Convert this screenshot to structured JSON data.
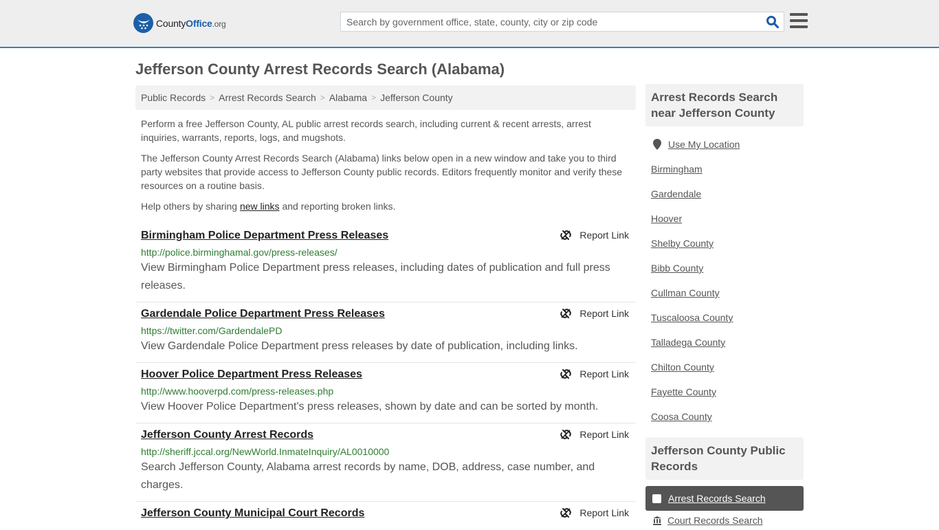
{
  "header": {
    "logo": {
      "county": "County",
      "office": "Office",
      "org": ".org"
    },
    "search_placeholder": "Search by government office, state, county, city or zip code",
    "search_value": ""
  },
  "page_title": "Jefferson County Arrest Records Search (Alabama)",
  "breadcrumb": [
    {
      "label": "Public Records"
    },
    {
      "label": "Arrest Records Search"
    },
    {
      "label": "Alabama"
    },
    {
      "label": "Jefferson County"
    }
  ],
  "intro": {
    "p1": "Perform a free Jefferson County, AL public arrest records search, including current & recent arrests, arrest inquiries, warrants, reports, logs, and mugshots.",
    "p2": "The Jefferson County Arrest Records Search (Alabama) links below open in a new window and take you to third party websites that provide access to Jefferson County public records. Editors frequently monitor and verify these resources on a routine basis.",
    "p3_before": "Help others by sharing ",
    "p3_link": "new links",
    "p3_after": " and reporting broken links."
  },
  "report_label": "Report Link",
  "results": [
    {
      "title": "Birmingham Police Department Press Releases",
      "url": "http://police.birminghamal.gov/press-releases/",
      "desc": "View Birmingham Police Department press releases, including dates of publication and full press releases."
    },
    {
      "title": "Gardendale Police Department Press Releases",
      "url": "https://twitter.com/GardendalePD",
      "desc": "View Gardendale Police Department press releases by date of publication, including links."
    },
    {
      "title": "Hoover Police Department Press Releases",
      "url": "http://www.hooverpd.com/press-releases.php",
      "desc": "View Hoover Police Department's press releases, shown by date and can be sorted by month."
    },
    {
      "title": "Jefferson County Arrest Records",
      "url": "http://sheriff.jccal.org/NewWorld.InmateInquiry/AL0010000",
      "desc": "Search Jefferson County, Alabama arrest records by name, DOB, address, case number, and charges."
    },
    {
      "title": "Jefferson County Municipal Court Records",
      "url": "",
      "desc": ""
    }
  ],
  "sidebar": {
    "nearby_heading": "Arrest Records Search near Jefferson County",
    "use_location": "Use My Location",
    "nearby": [
      "Birmingham",
      "Gardendale",
      "Hoover",
      "Shelby County",
      "Bibb County",
      "Cullman County",
      "Tuscaloosa County",
      "Talladega County",
      "Chilton County",
      "Fayette County",
      "Coosa County"
    ],
    "public_records_heading": "Jefferson County Public Records",
    "active_item": "Arrest Records Search",
    "next_item": "Court Records Search"
  },
  "colors": {
    "brand_blue": "#1c5fa8",
    "header_border": "#3a7fb5",
    "url_green": "#2e7d32",
    "active_bg": "#555555"
  }
}
